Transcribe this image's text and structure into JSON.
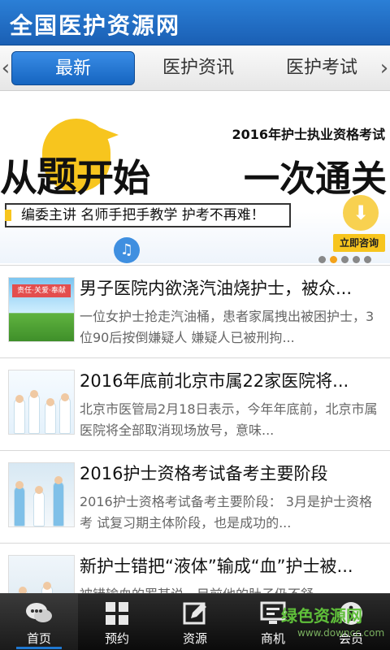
{
  "app": {
    "title": "全国医护资源网"
  },
  "tabs": [
    {
      "label": "最新",
      "active": true
    },
    {
      "label": "医护资讯",
      "active": false
    },
    {
      "label": "医护考试",
      "active": false
    }
  ],
  "banner": {
    "exam_title": "2016年护士执业资格考试",
    "headline_left_pre": "从",
    "headline_left_big": "题",
    "headline_left_post": "开始",
    "headline_right": "一次通关",
    "slogan": "编委主讲 名师手把手教学 护考不再难！",
    "consult_button": "立即咨询",
    "dots": 5,
    "active_dot": 1
  },
  "news": [
    {
      "title": "男子医院内欲浇汽油烧护士，被众...",
      "desc": "一位女护士抢走汽油桶，患者家属拽出被困护士，3位90后按倒嫌疑人 嫌疑人已被刑拘...",
      "thumb_text": "责任·关爱·奉献"
    },
    {
      "title": "2016年底前北京市属22家医院将...",
      "desc": "北京市医管局2月18日表示，今年年底前，北京市属医院将全部取消现场放号，意味...",
      "thumb_text": ""
    },
    {
      "title": "2016护士资格考试备考主要阶段",
      "desc": "2016护士资格考试备考主要阶段： 3月是护士资格考 试复习期主体阶段，也是成功的...",
      "thumb_text": ""
    },
    {
      "title": "新护士错把“液体”输成“血”护士被...",
      "desc": "被错输血的罗某说，目前他的肚子仍不舒",
      "thumb_text": ""
    }
  ],
  "bottom_nav": [
    {
      "label": "首页",
      "icon": "chat-bubbles-icon",
      "active": true
    },
    {
      "label": "预约",
      "icon": "grid-icon",
      "active": false
    },
    {
      "label": "资源",
      "icon": "edit-icon",
      "active": false
    },
    {
      "label": "商机",
      "icon": "monitor-icon",
      "active": false
    },
    {
      "label": "会员",
      "icon": "info-icon",
      "active": false
    }
  ],
  "watermark": {
    "text": "绿色资源网",
    "sub": "www.downcc.com"
  },
  "colors": {
    "primary": "#1a5fb4",
    "accent": "#f7c51e",
    "nav_bg": "#1a1a1a"
  }
}
